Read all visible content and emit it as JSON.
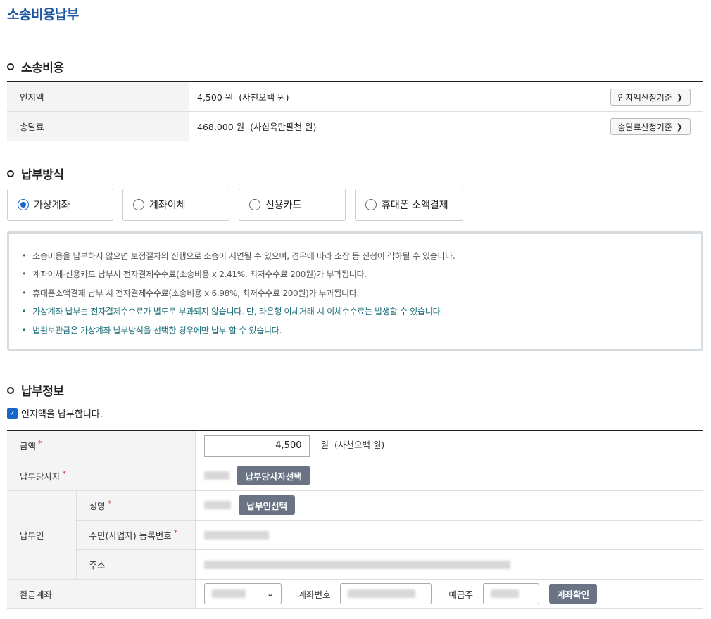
{
  "page": {
    "title": "소송비용납부"
  },
  "cost_section": {
    "title": "소송비용",
    "rows": [
      {
        "label": "인지액",
        "amount": "4,500 원",
        "words": "(사천오백 원)",
        "button": "인지액산정기준"
      },
      {
        "label": "송달료",
        "amount": "468,000 원",
        "words": "(사십육만팔천 원)",
        "button": "송달료산정기준"
      }
    ]
  },
  "method_section": {
    "title": "납부방식",
    "options": [
      {
        "label": "가상계좌",
        "selected": true
      },
      {
        "label": "계좌이체",
        "selected": false
      },
      {
        "label": "신용카드",
        "selected": false
      },
      {
        "label": "휴대폰 소액결제",
        "selected": false
      }
    ]
  },
  "notice": {
    "items": [
      {
        "text": "소송비용을 납부하지 않으면 보정절차의 진행으로 소송이 지연될 수 있으며, 경우에 따라 소장 등 신청이 각하될 수 있습니다.",
        "highlight": false
      },
      {
        "text": "계좌이체·신용카드 납부시 전자결제수수료(소송비용 x 2.41%, 최저수수료 200원)가 부과됩니다.",
        "highlight": false
      },
      {
        "text": "휴대폰소액결제 납부 시 전자결제수수료(소송비용 x 6.98%, 최저수수료 200원)가 부과됩니다.",
        "highlight": false
      },
      {
        "text": "가상계좌 납부는 전자결제수수료가 별도로 부과되지 않습니다. 단, 타은행 이체거래 시 이체수수료는 발생할 수 있습니다.",
        "highlight": true
      },
      {
        "text": "법원보관금은 가상계좌 납부방식을 선택한 경우에만 납부 할 수 있습니다.",
        "highlight": true
      }
    ],
    "highlight_color": "#1d6f79"
  },
  "info_section": {
    "title": "납부정보",
    "checkbox_label": "인지액을 납부합니다.",
    "checkbox_checked": true,
    "required_mark": "*",
    "amount": {
      "label": "금액",
      "value": "4,500",
      "unit": "원",
      "words": "(사천오백 원)"
    },
    "party": {
      "label": "납부당사자",
      "button": "납부당사자선택"
    },
    "payer": {
      "label": "납부인",
      "name_label": "성명",
      "name_button": "납부인선택",
      "id_label": "주민(사업자) 등록번호",
      "address_label": "주소"
    },
    "refund": {
      "label": "환급계좌",
      "account_label": "계좌번호",
      "holder_label": "예금주",
      "confirm_button": "계좌확인"
    }
  },
  "colors": {
    "accent": "#1b56a3",
    "radio": "#1a66c8",
    "dark_button": "#6a7384"
  }
}
